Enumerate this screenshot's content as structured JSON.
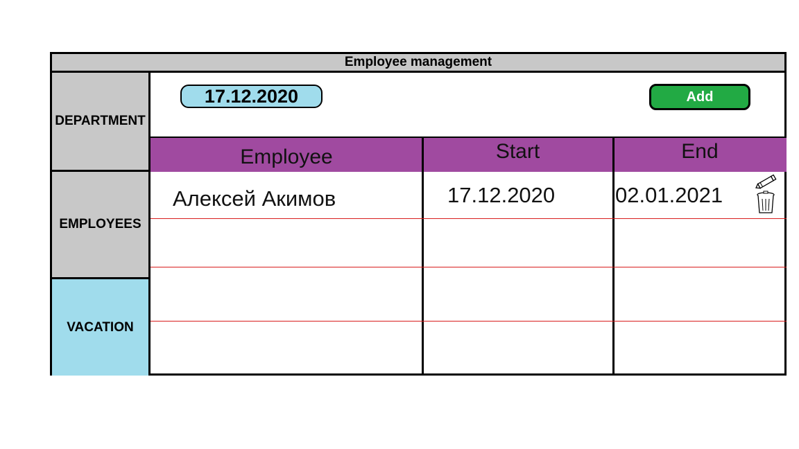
{
  "header": {
    "title": "Employee management"
  },
  "sidebar": {
    "department": "DEPARTMENT",
    "employees": "EMPLOYEES",
    "vacation": "VACATION"
  },
  "toolbar": {
    "date": "17.12.2020",
    "add_label": "Add"
  },
  "table": {
    "columns": [
      "Employee",
      "Start",
      "End"
    ],
    "rows": [
      {
        "employee": "Алексей Акимов",
        "start": "17.12.2020",
        "end": "02.01.2021"
      }
    ]
  },
  "icons": {
    "edit": "pencil-icon",
    "delete": "trash-icon"
  },
  "colors": {
    "title_bg": "#c8c8c8",
    "header_purple": "#a04aa0",
    "vacation_blue": "#a0dcec",
    "add_green": "#22aa44",
    "row_line_red": "#d81c1c"
  }
}
